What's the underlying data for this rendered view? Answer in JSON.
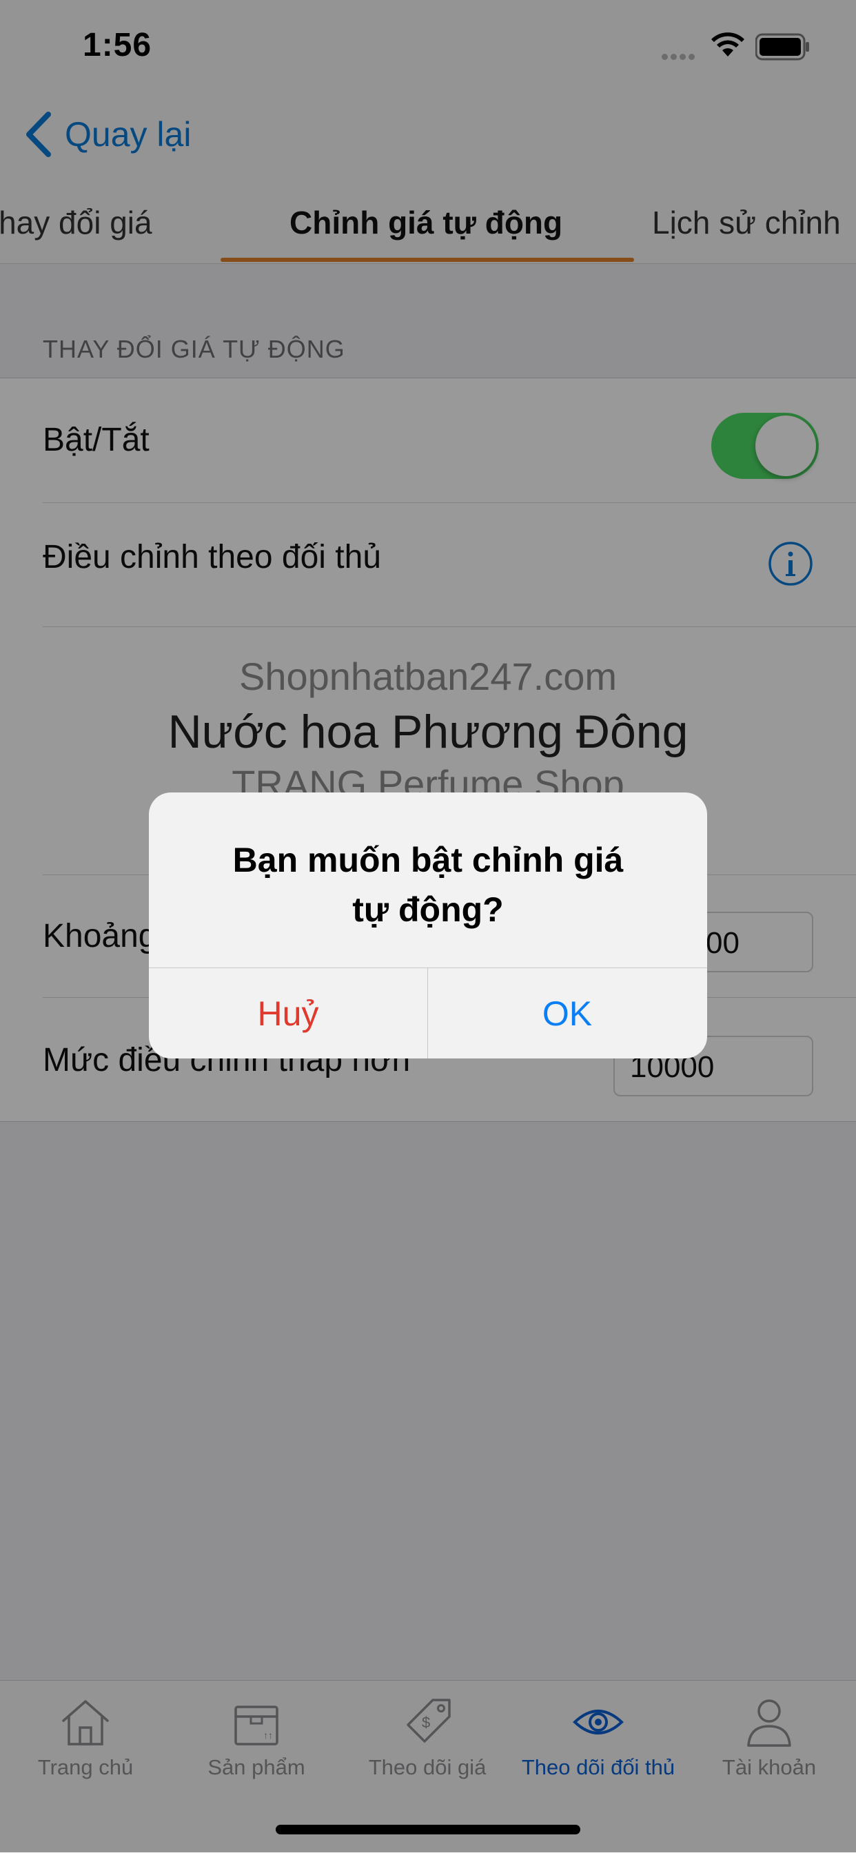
{
  "status_bar": {
    "time": "1:56"
  },
  "nav": {
    "back_label": "Quay lại"
  },
  "tabs": [
    {
      "label": "Thay đổi giá"
    },
    {
      "label": "Chỉnh giá tự động"
    },
    {
      "label": "Lịch sử chỉnh"
    }
  ],
  "section": {
    "header": "THAY ĐỔI GIÁ TỰ ĐỘNG"
  },
  "rows": {
    "toggle_label": "Bật/Tắt",
    "toggle_on": true,
    "competitor_label": "Điều chỉnh theo đối thủ",
    "range_label": "Khoảng",
    "range_value": "00",
    "lower_label": "Mức điều chỉnh thấp hơn",
    "lower_value": "10000"
  },
  "watermark": {
    "line1": "Shopnhatban247.com",
    "line2": "Nước hoa Phương Đông",
    "line3": "TRANG Perfume Shop"
  },
  "alert": {
    "title_line1": "Bạn muốn bật chỉnh giá",
    "title_line2": "tự động?",
    "cancel": "Huỷ",
    "ok": "OK"
  },
  "tabbar": [
    {
      "label": "Trang chủ",
      "icon": "home-icon"
    },
    {
      "label": "Sản phẩm",
      "icon": "box-icon"
    },
    {
      "label": "Theo dõi giá",
      "icon": "price-tag-icon"
    },
    {
      "label": "Theo dõi đối thủ",
      "icon": "eye-icon",
      "active": true
    },
    {
      "label": "Tài khoản",
      "icon": "user-icon"
    }
  ],
  "colors": {
    "accent": "#0b7ad6",
    "tab_underline": "#e08128",
    "toggle_on": "#4cd964",
    "cancel": "#e0392e",
    "ok": "#0a7ff5"
  }
}
